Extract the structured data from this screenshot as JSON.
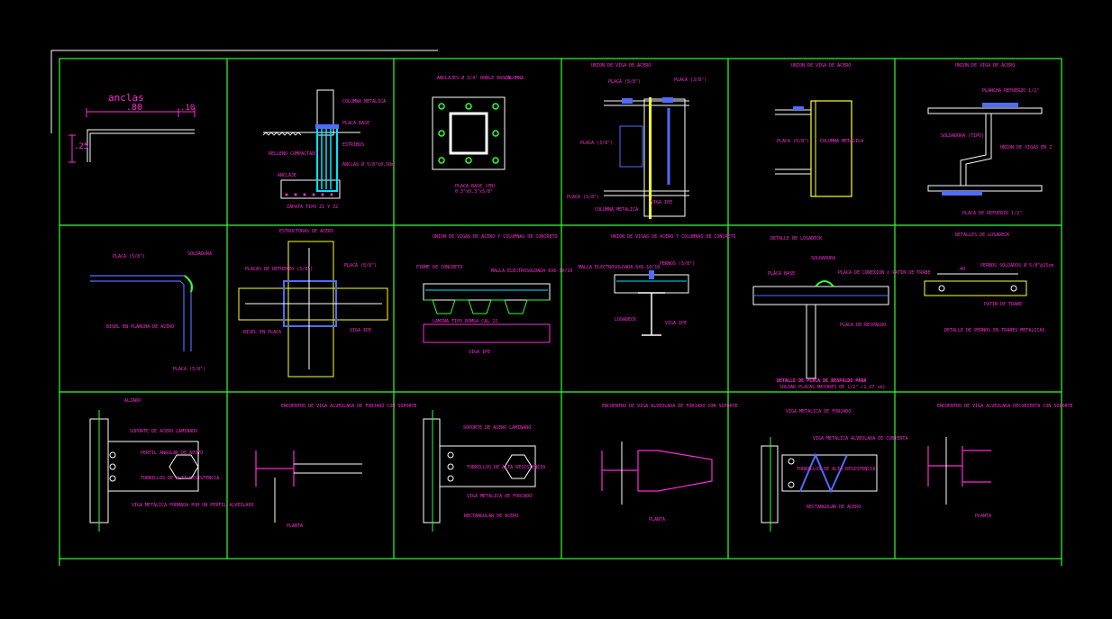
{
  "drawing": {
    "background_color": "#000000",
    "grid_color": "#33ff33",
    "label_color": "#ff2bd6",
    "cells": [
      {
        "id": "c00",
        "texts": [
          "anclas",
          ".80",
          ".10",
          ".25"
        ]
      },
      {
        "id": "c01",
        "texts": [
          "COLUMNA METALICA",
          "PLACA BASE",
          "ESTRIBOS",
          "RELLENO COMPACTADO",
          "ANCLAS Ø 5/8\"x0.50m",
          "ANCLAJE",
          "ZAPATA TIPO Z1 Y Z2"
        ]
      },
      {
        "id": "c02",
        "texts": [
          "ANCLAJES Ø 3/4\" DOBLE ROSCA",
          "COLUMNA",
          "PLACA BASE (PB)",
          "0.3\"x0.3\"x5/8\""
        ]
      },
      {
        "id": "c03",
        "texts": [
          "UNION DE VIGA DE ACERO",
          "PLACA (5/8\")",
          "PLACA (3/8\")",
          "PLACA (3/8\")",
          "PLACA (3/8\")",
          "COLUMNA METALICA",
          "VIGA IPE"
        ]
      },
      {
        "id": "c04",
        "texts": [
          "UNION DE VIGA DE ACERO",
          "PLACA (5/8\")",
          "COLUMNA METALICA"
        ]
      },
      {
        "id": "c05",
        "texts": [
          "UNION DE VIGA DE ACERO",
          "PLANCHA REFUERZO 1/2\"",
          "SOLDADURA (TIPO)",
          "UNION DE VIGAS EN Z",
          "PLACA DE REFUERZO 1/2\""
        ]
      },
      {
        "id": "c10",
        "texts": [
          "PLACA (5/8\")",
          "SOLDADURA",
          "BISEL EN PLANCHA DE ACERO",
          "PLACA (5/8\")"
        ]
      },
      {
        "id": "c11",
        "texts": [
          "ESTRUCTURAS DE ACERO",
          "PLACAS DE REFUERZO (5/8\")",
          "PLACA (5/8\")",
          "BISEL EN PLACA",
          "VIGA IPE"
        ]
      },
      {
        "id": "c12",
        "texts": [
          "UNION DE VIGAS DE ACERO Y COLUMNAS DE CONCRETO",
          "FIRME DE CONCRETO",
          "MALLA ELECTROSOLDADA 6X6-10/10",
          "LAMINA TIPO ROMSA CAL 22",
          "VIGA IPE"
        ]
      },
      {
        "id": "c13",
        "texts": [
          "UNION DE VIGAS DE ACERO Y COLUMNAS DE CONCRETO",
          "MALLA ELECTROSOLDADA 6X6-10/10",
          "PERNOS (5/8\")",
          "LOSADECK",
          "VIGA IPE"
        ]
      },
      {
        "id": "c14",
        "texts": [
          "DETALLE DE LOSADECK",
          "SOLDADURA",
          "PLACA BASE",
          "PLACA DE CONEXION ó PATIN DE TRABE",
          "PLACA DE RESPALDO",
          "DETALLE DE PLACA DE RESPALDO PARA",
          "SOLDAR PLACAS MAYORES DE 1/2\" (1.27 cm)"
        ]
      },
      {
        "id": "c15",
        "texts": [
          "DETALLES DE LOSADECK",
          ".40",
          "PERNOS SOLDADOS Ø 5/8\"@15cm",
          "PATIN DE TRABE",
          "DETALLE DE PERNOS EN TRABES METALICAS"
        ]
      },
      {
        "id": "c20",
        "texts": [
          "ALZADO",
          "SOPORTE DE ACERO LAMINADO",
          "PERFIL ANGULAR DE APOYO",
          "TORNILLOS DE ALTA RESISTENCIA",
          "VIGA METALICA FORMADA POR UN PERFIL ALVEOLADO"
        ]
      },
      {
        "id": "c21",
        "texts": [
          "ENCUENTRO DE VIGA ALVEOLADA DE FORJADO CON SOPORTE",
          "PLANTA"
        ]
      },
      {
        "id": "c22",
        "texts": [
          "SOPORTE DE ACERO LAMINADO",
          "TORNILLOS DE ALTA RESISTENCIA",
          "VIGA METALICA DE FORJADO",
          "RECTANGULAR DE ACERO"
        ]
      },
      {
        "id": "c23",
        "texts": [
          "ENCUENTRO DE VIGA ALVEOLADA DE FORJADO CON SOPORTE",
          "PLANTA"
        ]
      },
      {
        "id": "c24",
        "texts": [
          "VIGA METALICA DE FORJADO",
          "VIGA METALICA ALVEOLADA DE CUBIERTA",
          "TORNILLOS DE ALTA RESISTENCIA",
          "RECTANGULAR DE ACERO"
        ]
      },
      {
        "id": "c25",
        "texts": [
          "ENCUENTRO DE VIGA ALVEOLADA DECUBIERTA CON SOPORTE",
          "PLANTA"
        ]
      }
    ]
  }
}
